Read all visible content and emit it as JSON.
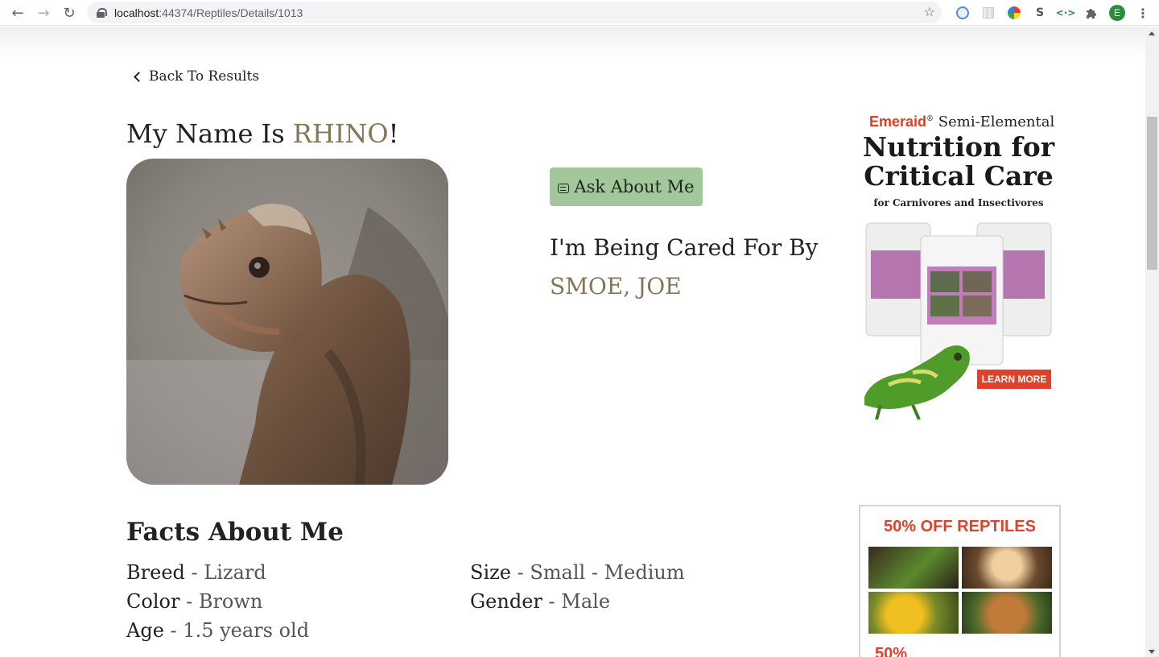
{
  "browser": {
    "url_host": "localhost",
    "url_path": ":44374/Reptiles/Details/1013",
    "profile_initial": "E"
  },
  "page": {
    "back_label": "Back To Results",
    "name_prefix": "My Name Is ",
    "pet_name": "RHINO",
    "name_suffix": "!",
    "ask_label": "Ask About Me",
    "cared_label": "I'm Being Cared For By",
    "caretaker": "SMOE, JOE",
    "facts_heading": "Facts About Me",
    "facts": {
      "breed": {
        "key": "Breed",
        "value": "Lizard"
      },
      "size": {
        "key": "Size",
        "value": "Small - Medium"
      },
      "color": {
        "key": "Color",
        "value": "Brown"
      },
      "gender": {
        "key": "Gender",
        "value": "Male"
      },
      "age": {
        "key": "Age",
        "value": "1.5 years old"
      }
    },
    "separator": "-"
  },
  "ads": {
    "ad1": {
      "brand_mark": "Emeraid",
      "brand_reg": "®",
      "brand_rest": " Semi-Elemental",
      "headline_1": "Nutrition for",
      "headline_2": "Critical Care",
      "sub": "for Carnivores and Insectivores",
      "cta": "LEARN MORE"
    },
    "ad2": {
      "headline": "50% OFF REPTILES",
      "more": "50%"
    }
  },
  "colors": {
    "accent": "#857657",
    "ask_button": "#a1c79b",
    "ad_red": "#e0412b"
  },
  "icons": {
    "back": "chevron-left-icon",
    "ask": "chat-icon",
    "star": "star-icon",
    "lock": "lock-icon"
  }
}
